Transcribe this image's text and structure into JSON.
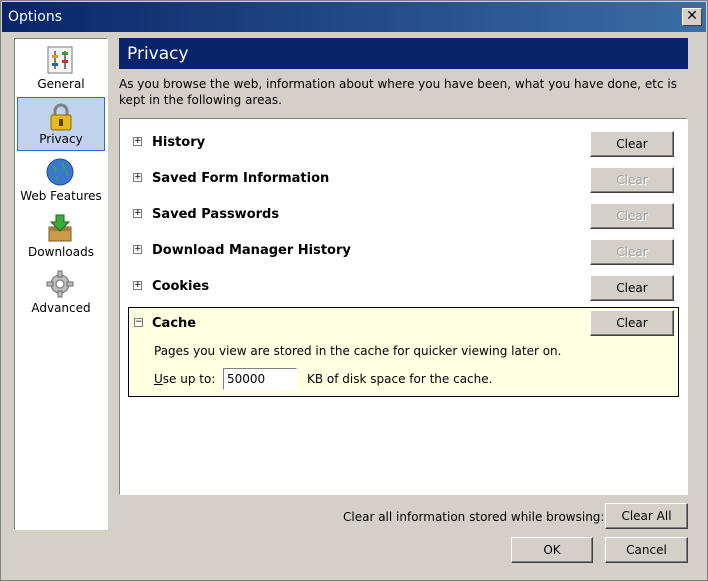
{
  "window": {
    "title": "Options",
    "close_label": "✕"
  },
  "sidebar": {
    "items": [
      {
        "label": "General",
        "icon": "general-icon"
      },
      {
        "label": "Privacy",
        "icon": "lock-icon",
        "selected": true
      },
      {
        "label": "Web Features",
        "icon": "globe-icon"
      },
      {
        "label": "Downloads",
        "icon": "downloads-icon"
      },
      {
        "label": "Advanced",
        "icon": "gear-icon"
      }
    ]
  },
  "panel": {
    "title": "Privacy",
    "intro": "As you browse the web, information about where you have been, what you have done, etc is kept in the following areas."
  },
  "privacy_items": [
    {
      "label": "History",
      "clear_label": "Clear",
      "enabled": true
    },
    {
      "label": "Saved Form Information",
      "clear_label": "Clear",
      "enabled": false
    },
    {
      "label": "Saved Passwords",
      "clear_label": "Clear",
      "enabled": false
    },
    {
      "label": "Download Manager History",
      "clear_label": "Clear",
      "enabled": false
    },
    {
      "label": "Cookies",
      "clear_label": "Clear",
      "enabled": true
    }
  ],
  "cache": {
    "label": "Cache",
    "clear_label": "Clear",
    "description": "Pages you view are stored in the cache for quicker viewing later on.",
    "use_up_to_label_u": "U",
    "use_up_to_label_rest": "se up to:",
    "value": "50000",
    "suffix": "KB of disk space for the cache."
  },
  "footer": {
    "clear_all_label": "Clear all information stored while browsing:",
    "clear_all_button": "Clear All",
    "ok_button": "OK",
    "cancel_button": "Cancel"
  }
}
